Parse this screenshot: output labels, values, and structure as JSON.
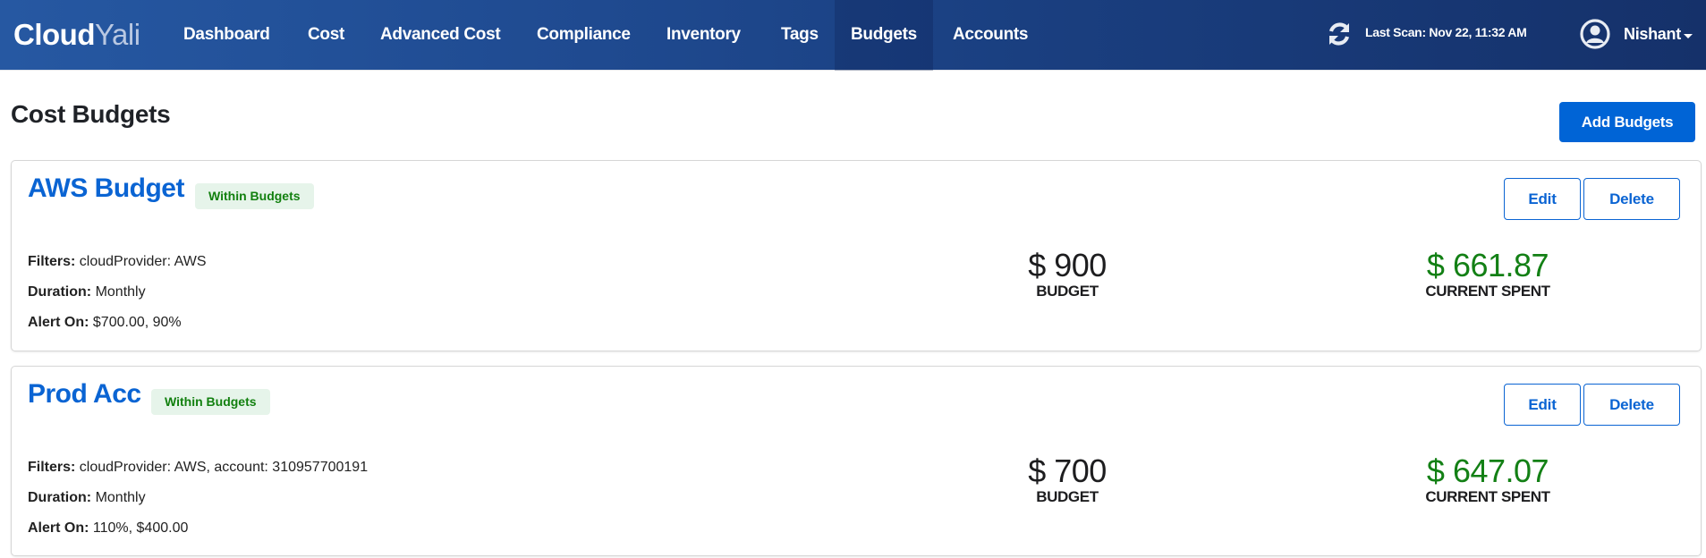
{
  "app": {
    "logo_part1": "Cloud",
    "logo_part2": "Yali"
  },
  "nav": {
    "items": [
      {
        "label": "Dashboard",
        "active": false
      },
      {
        "label": "Cost",
        "active": false
      },
      {
        "label": "Advanced Cost",
        "active": false
      },
      {
        "label": "Compliance",
        "active": false
      },
      {
        "label": "Inventory",
        "active": false
      },
      {
        "label": "Tags",
        "active": false
      },
      {
        "label": "Budgets",
        "active": true
      },
      {
        "label": "Accounts",
        "active": false
      }
    ],
    "last_scan": "Last Scan: Nov 22, 11:32 AM",
    "refresh_icon": "refresh-icon",
    "user_icon": "user-circle-icon",
    "user_name": "Nishant"
  },
  "page": {
    "title": "Cost Budgets",
    "add_button": "Add Budgets"
  },
  "budgets": [
    {
      "name": "AWS Budget",
      "status": "Within Budgets",
      "edit_label": "Edit",
      "delete_label": "Delete",
      "filters_label": "Filters:",
      "filters": "cloudProvider: AWS",
      "duration_label": "Duration:",
      "duration": "Monthly",
      "alert_label": "Alert On:",
      "alert": "$700.00, 90%",
      "budget_value": "$ 900",
      "budget_caption": "BUDGET",
      "spent_value": "$ 661.87",
      "spent_caption": "CURRENT SPENT"
    },
    {
      "name": "Prod Acc",
      "status": "Within Budgets",
      "edit_label": "Edit",
      "delete_label": "Delete",
      "filters_label": "Filters:",
      "filters": "cloudProvider: AWS, account: 310957700191",
      "duration_label": "Duration:",
      "duration": "Monthly",
      "alert_label": "Alert On:",
      "alert": "110%, $400.00",
      "budget_value": "$ 700",
      "budget_caption": "BUDGET",
      "spent_value": "$ 647.07",
      "spent_caption": "CURRENT SPENT"
    }
  ],
  "colors": {
    "brand_blue": "#0064d6",
    "link_blue": "#0a64d3",
    "status_green": "#138015",
    "badge_bg": "#e6f4ea",
    "nav_start": "#2658a2",
    "nav_end": "#15316a"
  }
}
